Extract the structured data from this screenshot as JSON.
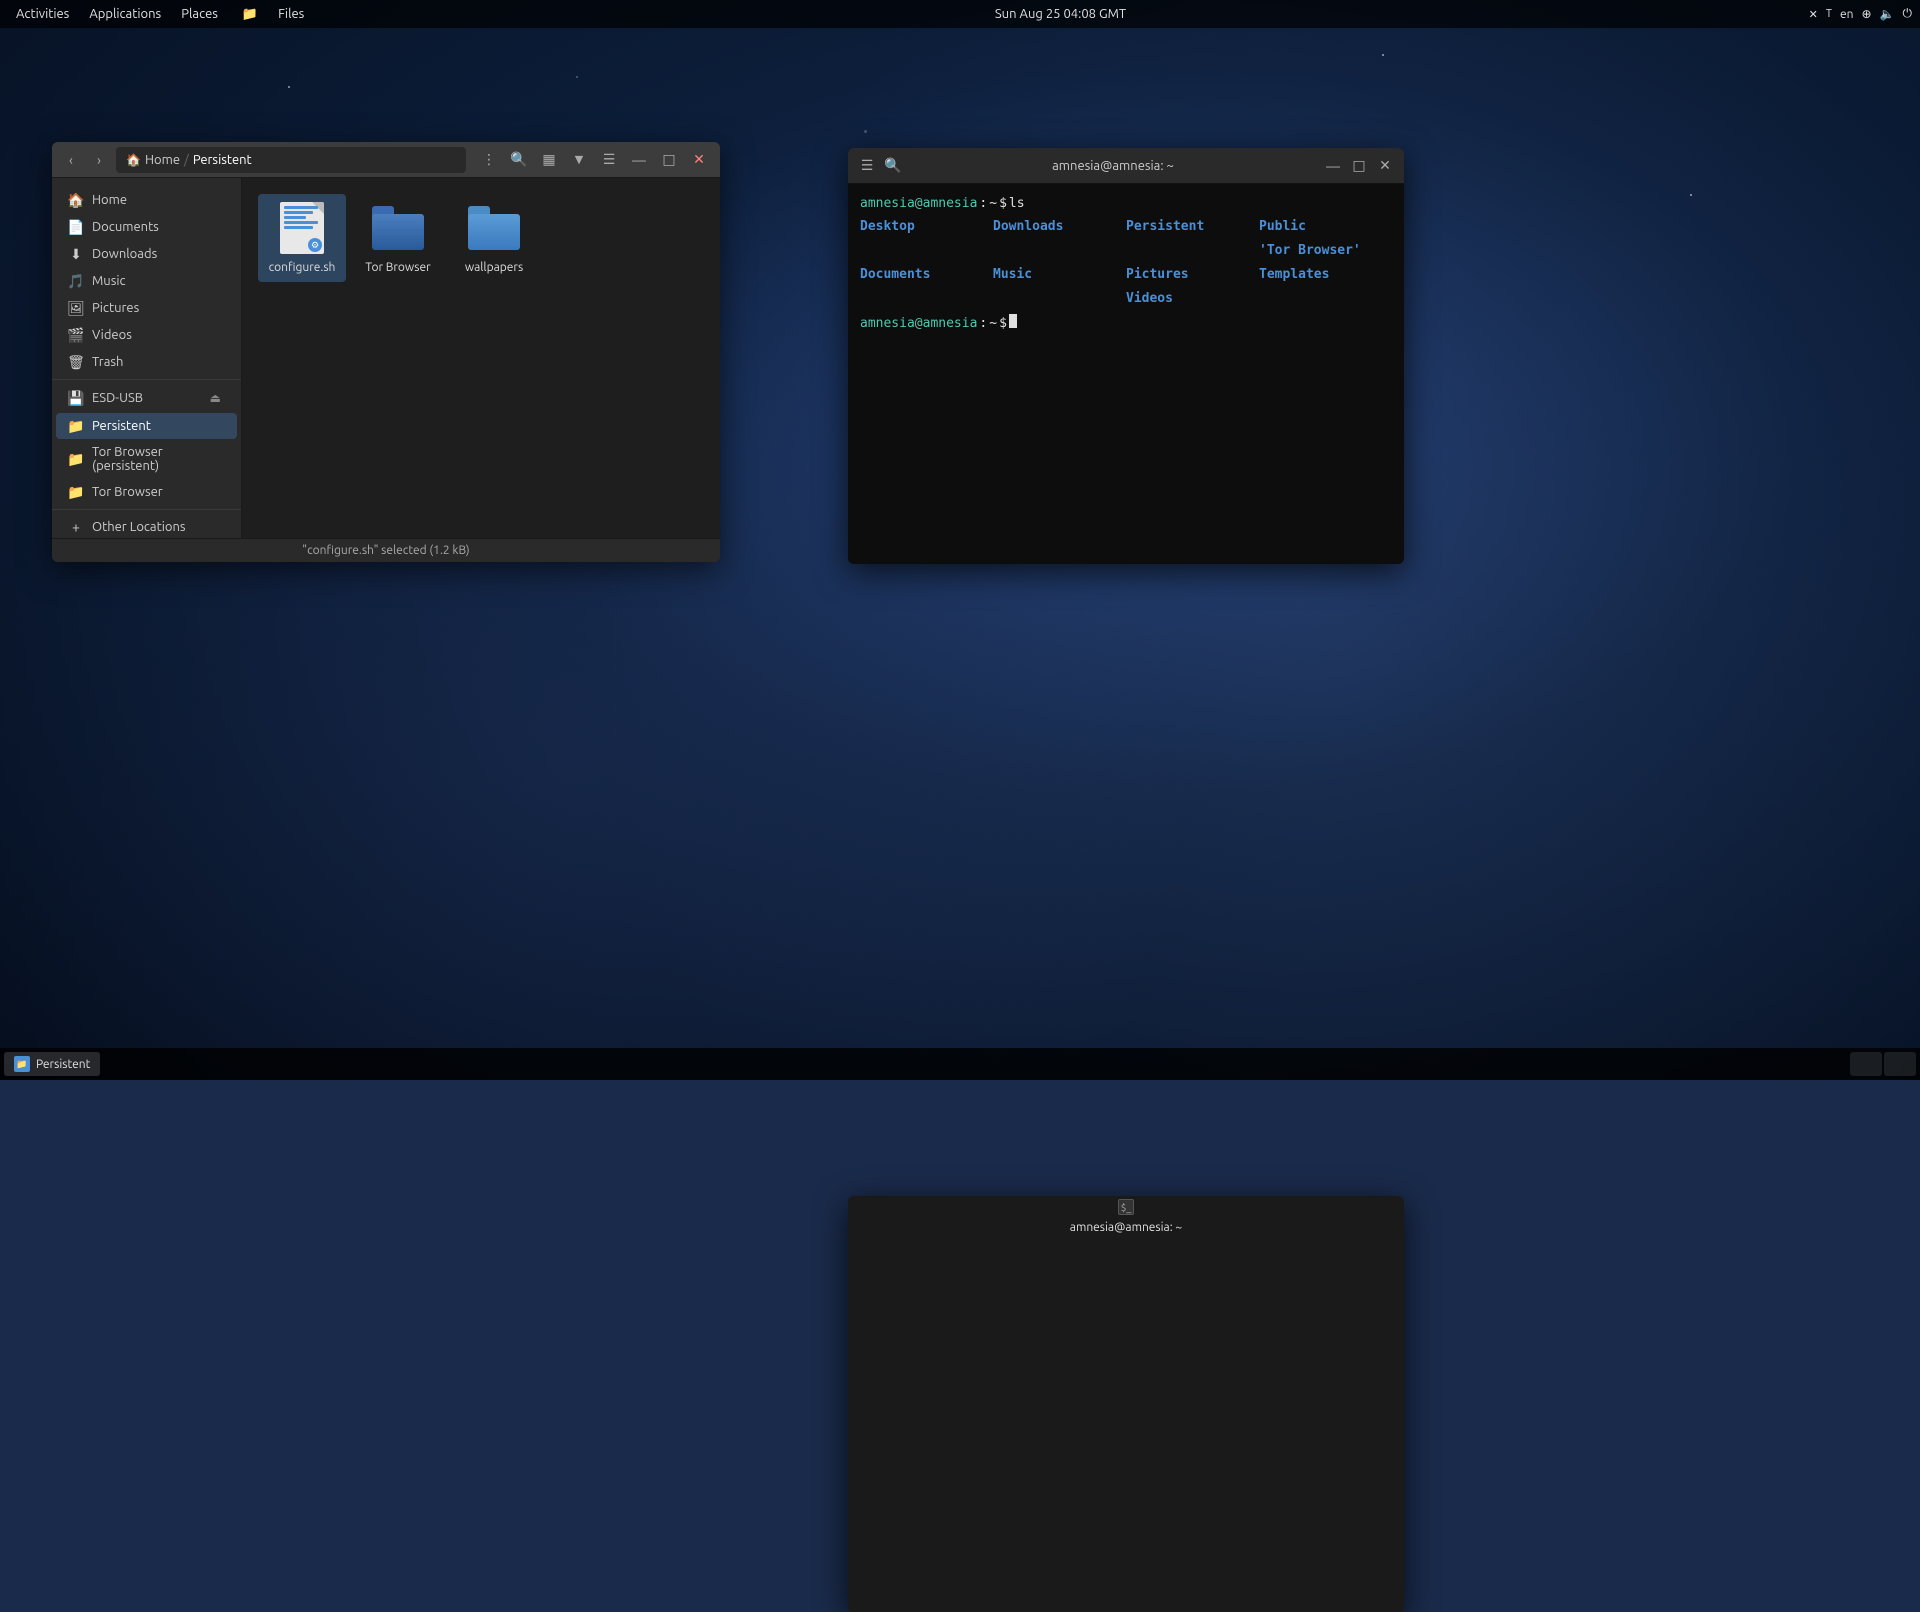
{
  "topbar": {
    "activities": "Activities",
    "applications": "Applications",
    "places": "Places",
    "files_icon": "📁",
    "files_label": "Files",
    "datetime": "Sun Aug 25  04:08 GMT",
    "lang": "en"
  },
  "file_manager": {
    "title": "Persistent",
    "breadcrumb_home": "Home",
    "breadcrumb_current": "Persistent",
    "statusbar_text": "\"configure.sh\" selected (1.2 kB)",
    "sidebar": {
      "home": "Home",
      "documents": "Documents",
      "downloads": "Downloads",
      "music": "Music",
      "pictures": "Pictures",
      "videos": "Videos",
      "trash": "Trash",
      "device_esd_usb": "ESD-USB",
      "persistent": "Persistent",
      "tor_browser_persistent": "Tor Browser (persistent)",
      "tor_browser": "Tor Browser",
      "other_locations": "Other Locations"
    },
    "files": [
      {
        "name": "configure.sh",
        "type": "script",
        "selected": true
      },
      {
        "name": "Tor Browser",
        "type": "folder",
        "color": "blue-dark"
      },
      {
        "name": "wallpapers",
        "type": "folder",
        "color": "blue"
      }
    ]
  },
  "terminal": {
    "title": "amnesia@amnesia: ~",
    "prompt_host": "amnesia@amnesia",
    "prompt_sep": ":",
    "prompt_dir": " ~",
    "prompt_dollar": "$",
    "command": " ls",
    "output": {
      "row1": [
        "Desktop",
        "Downloads",
        "Persistent",
        "Public",
        "'Tor Browser'"
      ],
      "row2": [
        "Documents",
        "Music",
        "Pictures",
        "Templates",
        "Videos"
      ]
    }
  },
  "taskbar": {
    "item1_label": "Persistent",
    "item2_label": "amnesia@amnesia: ~"
  }
}
